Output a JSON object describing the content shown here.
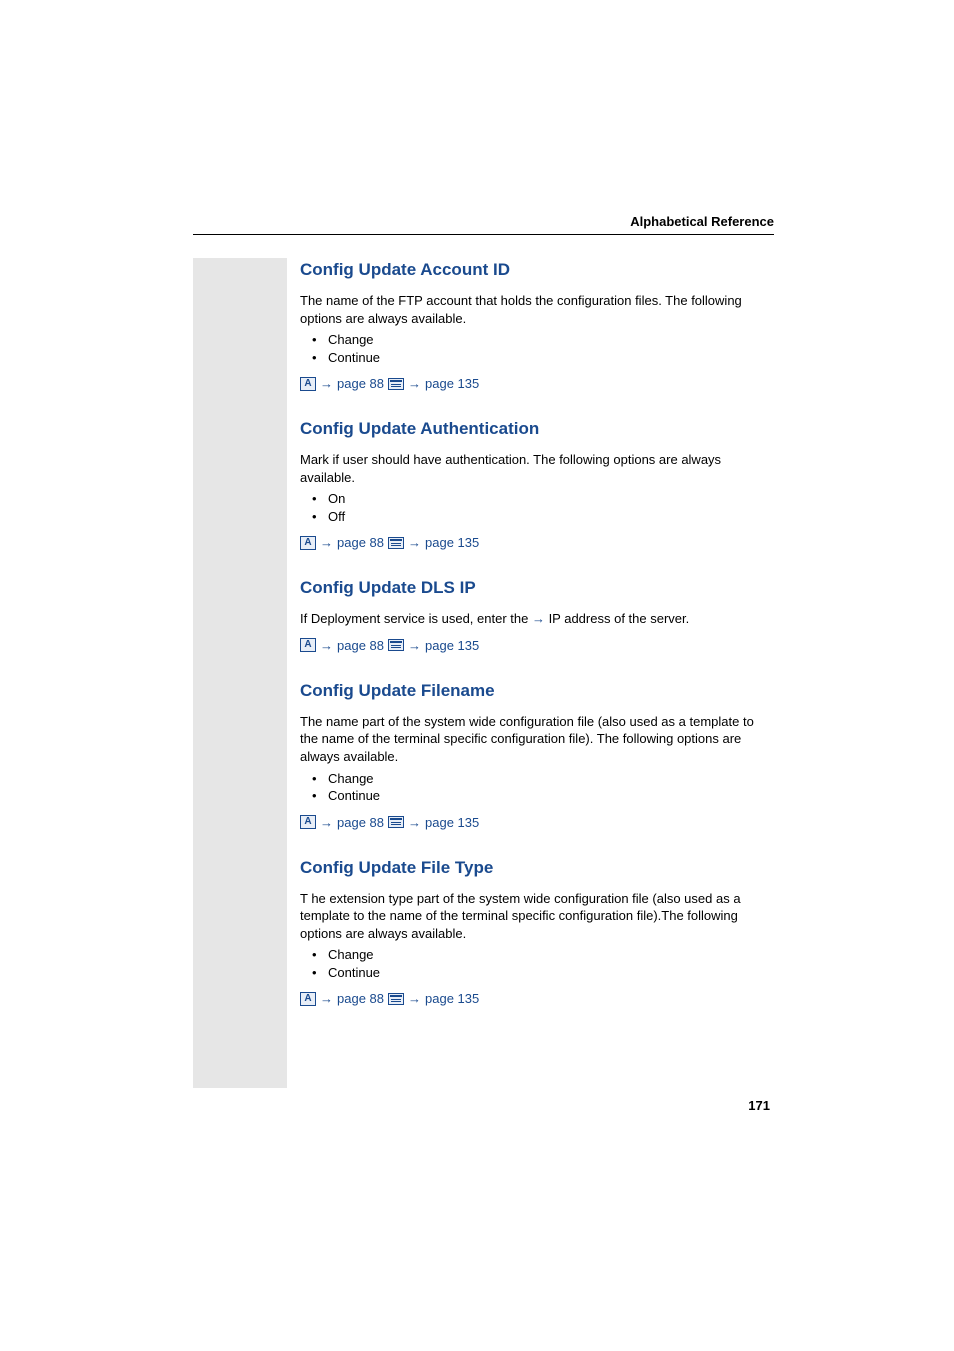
{
  "header": {
    "title": "Alphabetical Reference"
  },
  "sections": [
    {
      "title": "Config Update Account ID",
      "body": "The name of the FTP account that holds the configuration files. The following options are always available.",
      "bullets": [
        "Change",
        "Continue"
      ],
      "ref1": "page 88",
      "ref2": "page 135"
    },
    {
      "title": "Config Update Authentication",
      "body": "Mark if user should have authentication. The following options are always available.",
      "bullets": [
        "On",
        "Off"
      ],
      "ref1": "page 88",
      "ref2": "page 135"
    },
    {
      "title": "Config Update DLS IP",
      "body_prefix": "If Deployment service is used, enter the ",
      "body_suffix": " IP address of the server.",
      "bullets": [],
      "ref1": "page 88",
      "ref2": "page 135"
    },
    {
      "title": "Config Update Filename",
      "body": "The name part of the system wide configuration file (also used as a template to the name of the terminal specific configuration file). The following options are always available.",
      "bullets": [
        "Change",
        "Continue"
      ],
      "ref1": "page 88",
      "ref2": "page 135"
    },
    {
      "title": "Config Update File Type",
      "body": "T he extension type part of the system wide configuration file (also used as a template to the name of the terminal specific configuration file).The following options are always available.",
      "bullets": [
        "Change",
        "Continue"
      ],
      "ref1": "page 88",
      "ref2": "page 135"
    }
  ],
  "icon": {
    "letter": "A"
  },
  "pageNumber": "171"
}
